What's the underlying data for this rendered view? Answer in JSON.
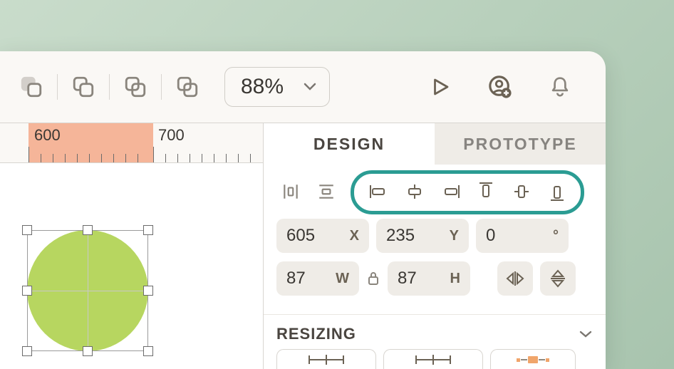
{
  "toolbar": {
    "zoom": "88%"
  },
  "ruler": {
    "label_600": "600",
    "label_700": "700"
  },
  "tabs": {
    "design": "DESIGN",
    "prototype": "PROTOTYPE"
  },
  "transform": {
    "x": "605",
    "x_label": "X",
    "y": "235",
    "y_label": "Y",
    "rotation": "0",
    "rotation_unit": "°",
    "w": "87",
    "w_label": "W",
    "h": "87",
    "h_label": "H"
  },
  "sections": {
    "resizing": "RESIZING"
  },
  "selected_shape": {
    "type": "ellipse",
    "fill": "#b7d660"
  }
}
